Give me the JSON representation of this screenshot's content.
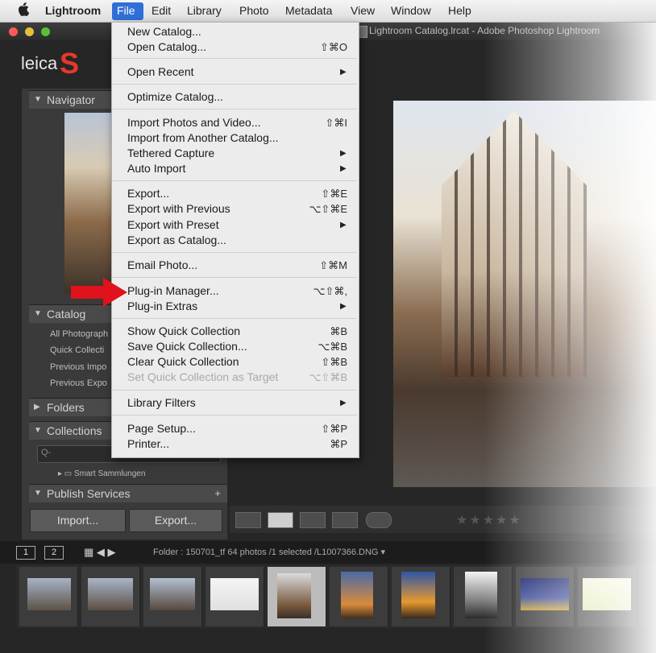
{
  "menubar": {
    "apple_icon": "apple-icon",
    "items": [
      "Lightroom",
      "File",
      "Edit",
      "Library",
      "Photo",
      "Metadata",
      "View",
      "Window",
      "Help"
    ]
  },
  "window": {
    "title": "Lightroom Catalog.lrcat - Adobe Photoshop Lightroom",
    "buttons": [
      "close",
      "minimize",
      "zoom"
    ],
    "colors": {
      "close": "#fc5b57",
      "minimize": "#e5bf3c",
      "zoom": "#57c038"
    }
  },
  "identity_plate": {
    "text": "leica",
    "accent": "S",
    "accent_color": "#e8382a"
  },
  "left_panel": {
    "navigator": "Navigator",
    "catalog": "Catalog",
    "catalog_rows": [
      "All Photograph",
      "Quick Collecti",
      "Previous Impo",
      "Previous Expo"
    ],
    "folders": "Folders",
    "collections": "Collections",
    "collection_search_placeholder": "Q-",
    "smart_collection": "Smart Sammlungen",
    "publish_services": "Publish Services",
    "publish_add": "+",
    "import_button": "Import...",
    "export_button": "Export..."
  },
  "file_menu": {
    "items": [
      {
        "label": "New Catalog...",
        "shortcut": "",
        "submenu": false,
        "disabled": false
      },
      {
        "label": "Open Catalog...",
        "shortcut": "⇧⌘O",
        "submenu": false,
        "disabled": false
      },
      {
        "label": "Open Recent",
        "shortcut": "",
        "submenu": true,
        "disabled": false
      },
      {
        "label": "Optimize Catalog...",
        "shortcut": "",
        "submenu": false,
        "disabled": false
      },
      {
        "label": "Import Photos and Video...",
        "shortcut": "⇧⌘I",
        "submenu": false,
        "disabled": false
      },
      {
        "label": "Import from Another Catalog...",
        "shortcut": "",
        "submenu": false,
        "disabled": false
      },
      {
        "label": "Tethered Capture",
        "shortcut": "",
        "submenu": true,
        "disabled": false
      },
      {
        "label": "Auto Import",
        "shortcut": "",
        "submenu": true,
        "disabled": false
      },
      {
        "label": "Export...",
        "shortcut": "⇧⌘E",
        "submenu": false,
        "disabled": false
      },
      {
        "label": "Export with Previous",
        "shortcut": "⌥⇧⌘E",
        "submenu": false,
        "disabled": false
      },
      {
        "label": "Export with Preset",
        "shortcut": "",
        "submenu": true,
        "disabled": false
      },
      {
        "label": "Export as Catalog...",
        "shortcut": "",
        "submenu": false,
        "disabled": false
      },
      {
        "label": "Email Photo...",
        "shortcut": "⇧⌘M",
        "submenu": false,
        "disabled": false
      },
      {
        "label": "Plug-in Manager...",
        "shortcut": "⌥⇧⌘,",
        "submenu": false,
        "disabled": false
      },
      {
        "label": "Plug-in Extras",
        "shortcut": "",
        "submenu": true,
        "disabled": false
      },
      {
        "label": "Show Quick Collection",
        "shortcut": "⌘B",
        "submenu": false,
        "disabled": false
      },
      {
        "label": "Save Quick Collection...",
        "shortcut": "⌥⌘B",
        "submenu": false,
        "disabled": false
      },
      {
        "label": "Clear Quick Collection",
        "shortcut": "⇧⌘B",
        "submenu": false,
        "disabled": false
      },
      {
        "label": "Set Quick Collection as Target",
        "shortcut": "⌥⇧⌘B",
        "submenu": false,
        "disabled": true
      },
      {
        "label": "Library Filters",
        "shortcut": "",
        "submenu": true,
        "disabled": false
      },
      {
        "label": "Page Setup...",
        "shortcut": "⇧⌘P",
        "submenu": false,
        "disabled": false
      },
      {
        "label": "Printer...",
        "shortcut": "⌘P",
        "submenu": false,
        "disabled": false
      }
    ],
    "highlight_arrow_color": "#e0121c"
  },
  "toolbar": {
    "view_icons": [
      "grid-view-icon",
      "loupe-view-icon",
      "compare-view-icon",
      "survey-view-icon",
      "people-view-icon"
    ],
    "rating": "★★★★★"
  },
  "filmstrip_bar": {
    "page1": "1",
    "page2": "2",
    "info": "Folder : 150701_tf    64 photos /1 selected /L1007366.DNG ▾"
  }
}
